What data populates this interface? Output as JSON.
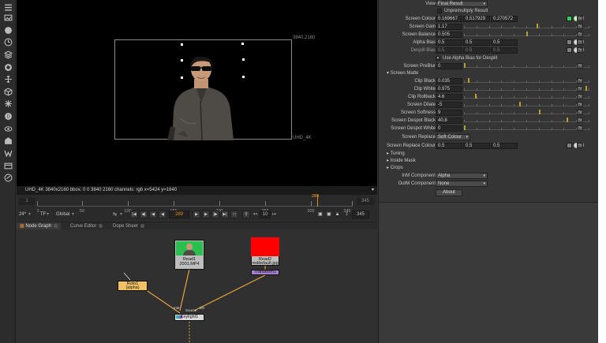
{
  "viewer": {
    "format_label": "3840,2160",
    "format_name": "UHD_4K",
    "info_bar": "UHD_4K 3840x2160  bbox: 0 0 3840 2160 channels: rgb  x=5424 y=1640"
  },
  "timeline": {
    "range_start": "1",
    "range_end": "345",
    "current_frame": "289",
    "ticks": [
      "1",
      "50",
      "100",
      "150",
      "200",
      "250",
      "300",
      "345"
    ],
    "fps": "24*",
    "tf": "TF",
    "scope": "Global",
    "frame_field": "289",
    "step": "10",
    "end_field": "345"
  },
  "tabs": [
    {
      "label": "Node Graph"
    },
    {
      "label": "Curve Editor"
    },
    {
      "label": "Dope Sheet"
    }
  ],
  "nodes": {
    "read1": {
      "title": "Read1",
      "sub": "2001.MP4"
    },
    "read2": {
      "title": "Read2",
      "sub": "reddefault.jpg"
    },
    "transform": {
      "title": "Transform1"
    },
    "roto": {
      "title": "Roto1",
      "sub": "(alpha)"
    },
    "keylight": {
      "title": "Keylight1"
    },
    "labels": {
      "source": "Source",
      "bg": "BG",
      "ina": "InM"
    }
  },
  "properties": {
    "view": {
      "label": "View",
      "value": "Final Result"
    },
    "unpremultiply": {
      "label": "Unpremultiply Result"
    },
    "screen_colour": {
      "label": "Screen Colour",
      "r": "0.169667",
      "g": "0.517929",
      "b": "0.270572"
    },
    "screen_gain": {
      "label": "Screen Gain",
      "value": "1.17"
    },
    "screen_balance": {
      "label": "Screen Balance",
      "value": "0.505"
    },
    "alpha_bias": {
      "label": "Alpha Bias",
      "r": "0.5",
      "g": "0.5",
      "b": "0.5"
    },
    "despill_bias": {
      "label": "Despill Bias",
      "r": "0.5",
      "g": "0.5",
      "b": "0.5"
    },
    "use_alpha_bias": {
      "label": "Use Alpha Bias for Despill"
    },
    "prebur": {
      "label": "Screen PreBlur",
      "value": "0"
    },
    "screen_matte": {
      "label": "Screen Matte"
    },
    "clip_black": {
      "label": "Clip Black",
      "value": "0.035"
    },
    "clip_white": {
      "label": "Clip White",
      "value": "0.975"
    },
    "clip_rollback": {
      "label": "Clip Rollback",
      "value": "4.6"
    },
    "screen_dilate": {
      "label": "Screen Dilate",
      "value": "-5"
    },
    "screen_softness": {
      "label": "Screen Softness",
      "value": "9"
    },
    "despot_black": {
      "label": "Screen Despot Black",
      "value": "40.8"
    },
    "despot_white": {
      "label": "Screen Despot White",
      "value": "0"
    },
    "screen_replace": {
      "label": "Screen Replace",
      "value": "Soft Colour"
    },
    "replace_colour": {
      "label": "Screen Replace Colour",
      "r": "0.5",
      "g": "0.5",
      "b": "0.5"
    },
    "tuning": {
      "label": "Tuning"
    },
    "inside_mask": {
      "label": "Inside Mask"
    },
    "crops": {
      "label": "Crops"
    },
    "inm_component": {
      "label": "InM Component",
      "value": "Alpha"
    },
    "outm_component": {
      "label": "OutM Component",
      "value": "None"
    },
    "about": {
      "label": "About"
    },
    "channel_count": "3"
  },
  "slider_ticks": {
    "gain": [
      "0",
      "0.2",
      "0.4",
      "0.6",
      "0.8",
      "1",
      "1.2",
      "1.4",
      "1.6",
      "1.8",
      "2"
    ],
    "balance": [
      "0",
      "0.1",
      "0.2",
      "0.3",
      "0.4",
      "0.5",
      "0.6",
      "0.7",
      "0.8",
      "0.9",
      "1"
    ]
  },
  "colors": {
    "screen_swatch": "#2bcf59",
    "accent": "#e68a1e",
    "read2_thumb": "#ff0000",
    "roto_node": "#f1c265",
    "transform_node": "#a77fd0",
    "keylight_node": "#d8d8d8"
  }
}
